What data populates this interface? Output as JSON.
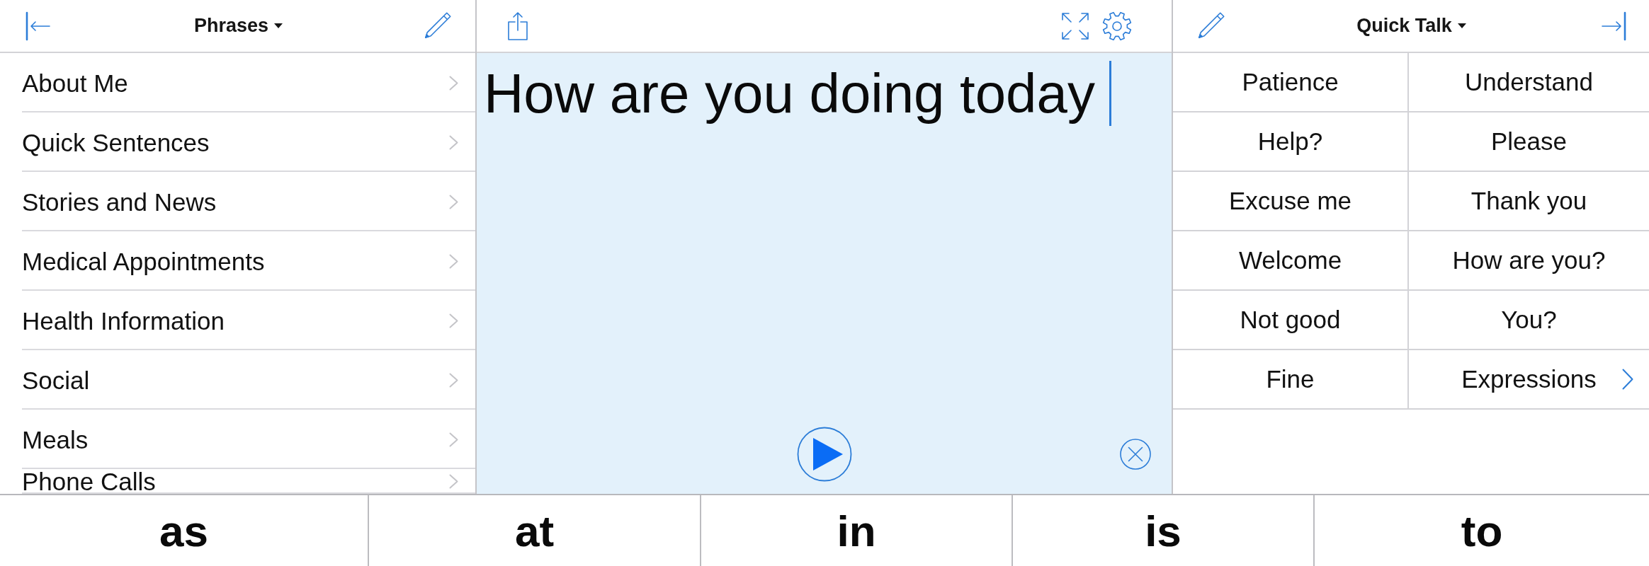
{
  "left_panel": {
    "title": "Phrases",
    "items": [
      "About Me",
      "Quick Sentences",
      "Stories and News",
      "Medical Appointments",
      "Health Information",
      "Social",
      "Meals",
      "Phone Calls"
    ]
  },
  "editor": {
    "text": "How are you doing today"
  },
  "right_panel": {
    "title": "Quick Talk",
    "cells": [
      {
        "label": "Patience",
        "kind": "phrase"
      },
      {
        "label": "Understand",
        "kind": "phrase"
      },
      {
        "label": "Help?",
        "kind": "phrase"
      },
      {
        "label": "Please",
        "kind": "phrase"
      },
      {
        "label": "Excuse me",
        "kind": "phrase"
      },
      {
        "label": "Thank you",
        "kind": "phrase"
      },
      {
        "label": "Welcome",
        "kind": "phrase"
      },
      {
        "label": "How are you?",
        "kind": "phrase"
      },
      {
        "label": "Not good",
        "kind": "phrase"
      },
      {
        "label": "You?",
        "kind": "phrase"
      },
      {
        "label": "Fine",
        "kind": "phrase"
      },
      {
        "label": "Expressions",
        "kind": "folder"
      }
    ]
  },
  "suggestions": [
    {
      "word": "as"
    },
    {
      "word": "at"
    },
    {
      "word": "in"
    },
    {
      "word": "is"
    },
    {
      "word": "to"
    }
  ]
}
